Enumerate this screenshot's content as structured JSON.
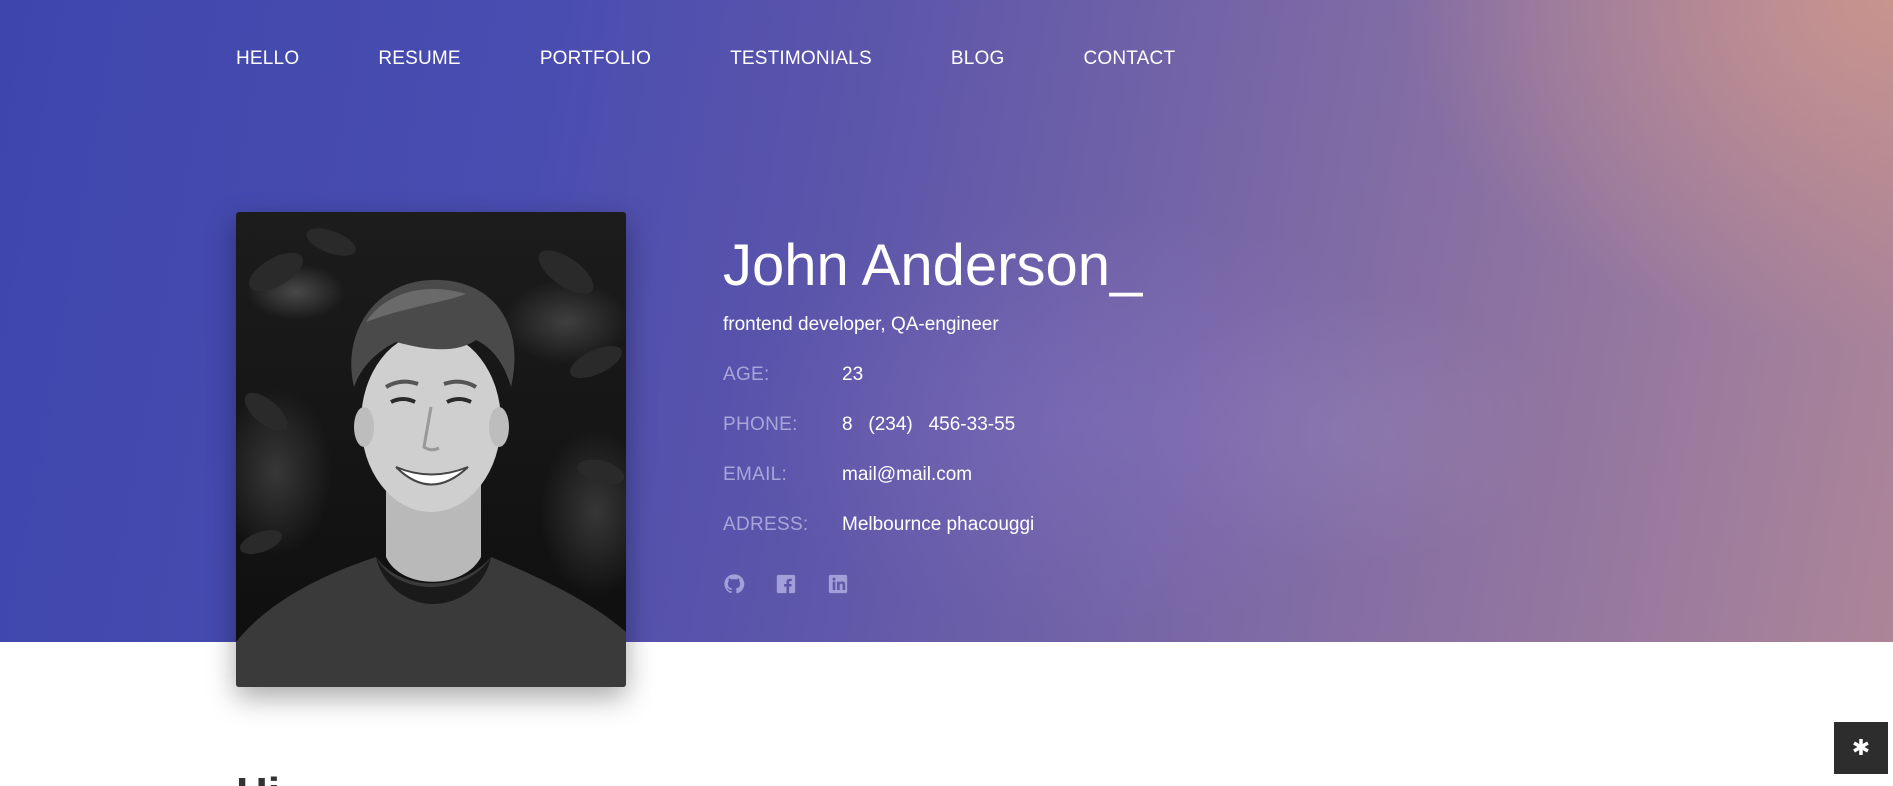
{
  "nav": {
    "items": [
      {
        "label": "HELLO"
      },
      {
        "label": "RESUME"
      },
      {
        "label": "PORTFOLIO"
      },
      {
        "label": "TESTIMONIALS"
      },
      {
        "label": "BLOG"
      },
      {
        "label": "CONTACT"
      }
    ]
  },
  "profile": {
    "name": "John Anderson_",
    "role": "frontend developer, QA-engineer",
    "details": [
      {
        "label": "AGE:",
        "value": "23"
      },
      {
        "label": "PHONE:",
        "value": "8   (234)   456-33-55"
      },
      {
        "label": "EMAIL:",
        "value": "mail@mail.com"
      },
      {
        "label": "ADRESS:",
        "value": "Melbournce phacouggi"
      }
    ],
    "social": [
      {
        "icon": "github-icon"
      },
      {
        "icon": "facebook-icon"
      },
      {
        "icon": "linkedin-icon"
      }
    ]
  },
  "section": {
    "heading": "Hi"
  },
  "fab": {
    "icon": "gear-icon",
    "glyph": "✱"
  },
  "colors": {
    "hero_start": "#3e46ad",
    "hero_end": "#ad8598",
    "label": "#a9a5db",
    "fab_bg": "#2d2d2d"
  }
}
